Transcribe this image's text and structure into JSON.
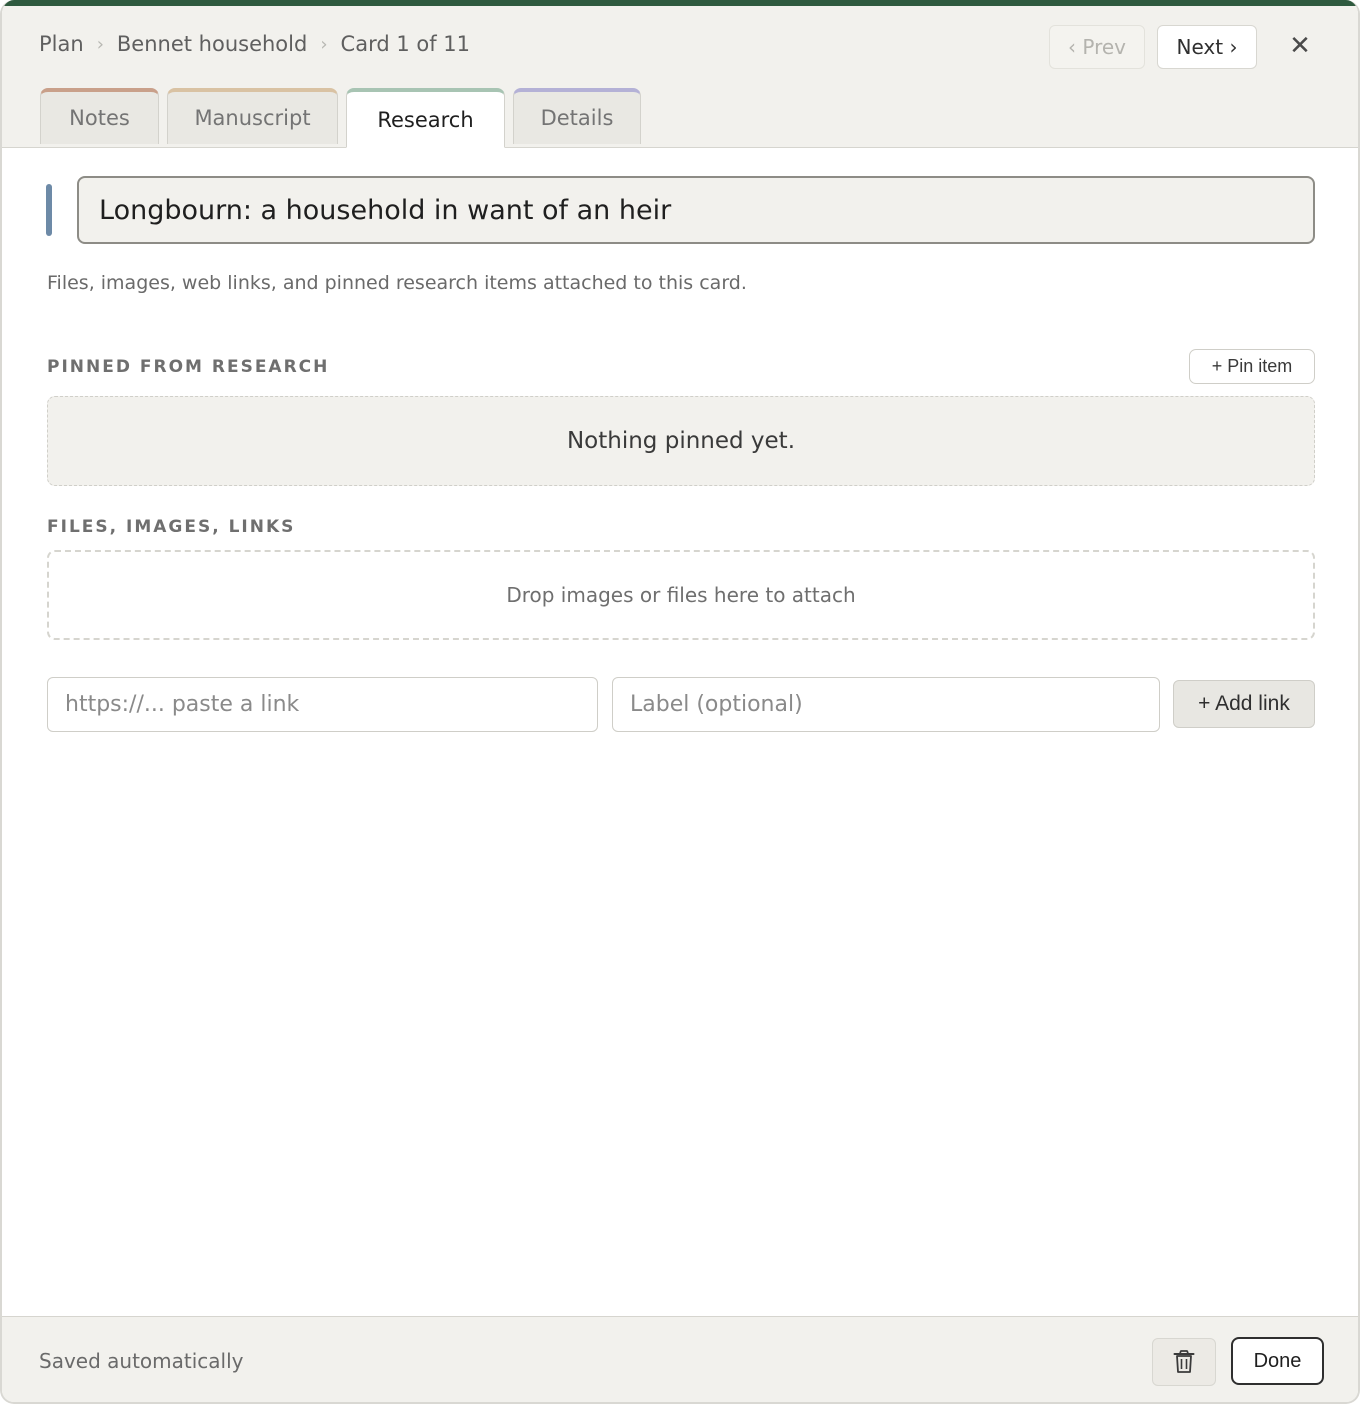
{
  "breadcrumb": {
    "items": [
      "Plan",
      "Bennet household",
      "Card 1 of 11"
    ],
    "separator": "›"
  },
  "nav": {
    "prev_label": "‹ Prev",
    "next_label": "Next ›",
    "close_glyph": "✕"
  },
  "tabs": [
    {
      "label": "Notes",
      "active": false,
      "accent": "#c9a08a"
    },
    {
      "label": "Manuscript",
      "active": false,
      "accent": "#d9c2a3"
    },
    {
      "label": "Research",
      "active": true,
      "accent": "#a8c4b3"
    },
    {
      "label": "Details",
      "active": false,
      "accent": "#b4b1d6"
    }
  ],
  "card": {
    "title": "Longbourn: a household in want of an heir",
    "description": "Files, images, web links, and pinned research items attached to this card."
  },
  "pinned": {
    "heading": "PINNED FROM RESEARCH",
    "pin_button": "+ Pin item",
    "empty_text": "Nothing pinned yet."
  },
  "files": {
    "heading": "FILES, IMAGES, LINKS",
    "drop_text": "Drop images or files here to attach",
    "link_placeholder": "https://... paste a link",
    "label_placeholder": "Label (optional)",
    "add_link_button": "+ Add link"
  },
  "footer": {
    "status": "Saved automatically",
    "done_button": "Done",
    "delete_icon": "trash-icon"
  },
  "colors": {
    "top_accent": "#2f5a3f",
    "title_accent": "#6d8aa7"
  }
}
